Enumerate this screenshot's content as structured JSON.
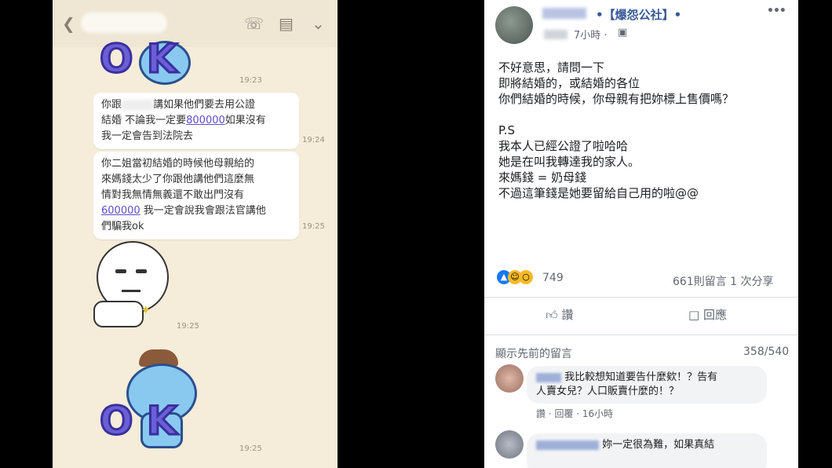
{
  "chat": {
    "okk_text_1": "O  K",
    "okk_text_2": "O  K",
    "bubble1_lines": [
      "你跟",
      "講如果他們要去用公證",
      "結婚 不論我一定要",
      "如果沒有",
      "我一定會告到法院去"
    ],
    "bubble1_amount": "800000",
    "bubble2_lines": [
      "你二姐當初結婚的時候他母親給的",
      "來媽錢太少了你跟他講他們這麼無",
      "情對我無情無義還不敢出門沒有",
      "我一定會說我會跟法官講他",
      "們騙我ok"
    ],
    "bubble2_amount": "600000",
    "times": [
      "19:23",
      "19:24",
      "19:25",
      "19:25",
      "19:25"
    ]
  },
  "fb": {
    "page_name": "•【爆怨公社】•",
    "post_time": "7小時 · ",
    "more": "•••",
    "post_lines": [
      "不好意思，請問一下",
      "即將結婚的，或結婚的各位",
      "你們結婚的時候，你母親有把妳標上售價嗎？",
      "",
      "P.S",
      "我本人已經公證了啦哈哈",
      "她是在叫我轉達我的家人。",
      "來媽錢 = 奶母錢",
      "不過這筆錢是她要留給自己用的啦@@"
    ],
    "reaction_count": "749",
    "comment_share": "661則留言  1 次分享",
    "like_label": "讚",
    "comment_label": "回應",
    "prev_comments": "顯示先前的留言",
    "comment_counter": "358/540",
    "comment1_lines": [
      "我比較想知道要告什麼欸！？告有",
      "人賣女兒？人口販賣什麼的！？"
    ],
    "comment1_actions": "讚 · 回覆 · 16小時",
    "comment2_lines": [
      "妳一定很為難，如果真結"
    ],
    "colors": {
      "accent": "#1877f2",
      "bubble_link": "#5b4ec9"
    }
  }
}
